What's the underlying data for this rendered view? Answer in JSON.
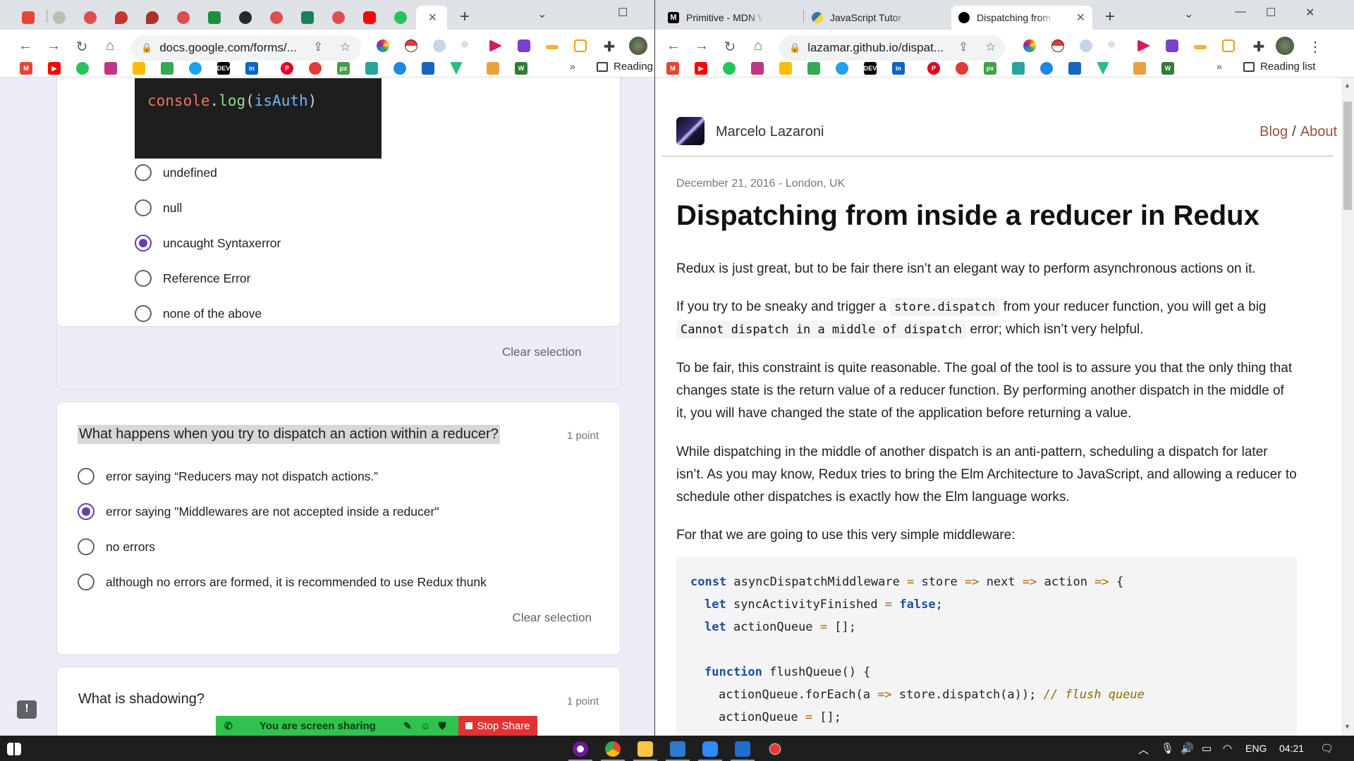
{
  "left_window": {
    "tabs": {
      "active_close": "✕",
      "new_tab": "+"
    },
    "omnibox": {
      "url": "docs.google.com/forms/..."
    },
    "bookmarks": {
      "reading_list": "Reading",
      "more": "»"
    },
    "form": {
      "code_snippet": {
        "prefix": "console",
        "dot": ".",
        "fn": "log",
        "paren_open": "(",
        "arg": "isAuth",
        "paren_close": ")"
      },
      "q1": {
        "options": [
          "undefined",
          "null",
          "uncaught Syntaxerror",
          "Reference Error",
          "none of the above"
        ],
        "selected_index": 2,
        "clear": "Clear selection"
      },
      "q2": {
        "title": "What happens when you try to dispatch an action within a reducer?",
        "points": "1 point",
        "options": [
          "error saying “Reducers may not dispatch actions.”",
          "error saying \"Middlewares are not accepted inside a reducer\"",
          "no errors",
          "although no errors are formed, it is recommended to use Redux thunk"
        ],
        "selected_index": 1,
        "clear": "Clear selection"
      },
      "q3": {
        "title": "What is shadowing?",
        "points": "1 point"
      }
    },
    "share_bar": {
      "status": "You are screen sharing",
      "stop": "Stop Share"
    }
  },
  "right_window": {
    "tabs": [
      {
        "title": "Primitive - MDN W",
        "active": false
      },
      {
        "title": "JavaScript Tutor - V",
        "active": false
      },
      {
        "title": "Dispatching from i",
        "active": true
      }
    ],
    "new_tab": "+",
    "omnibox": {
      "url": "lazamar.github.io/dispat..."
    },
    "bookmarks": {
      "reading_list": "Reading list",
      "more": "»"
    },
    "blog": {
      "author": "Marcelo Lazaroni",
      "nav": {
        "blog": "Blog",
        "sep": "/",
        "about": "About"
      },
      "meta": "December 21, 2016 - London, UK",
      "title": "Dispatching from inside a reducer in Redux",
      "p1": "Redux is just great, but to be fair there isn’t an elegant way to perform asynchronous actions on it.",
      "p2": {
        "a": "If you try to be sneaky and trigger a",
        "code1": "store.dispatch",
        "b": "from your reducer function, you will get a big",
        "code2": "Cannot dispatch in a middle of dispatch",
        "c": "error; which isn’t very helpful."
      },
      "p3": "To be fair, this constraint is quite reasonable. The goal of the tool is to assure you that the only thing that changes state is the return value of a reducer function. By performing another dispatch in the middle of it, you will have changed the state of the application before returning a value.",
      "p4": "While dispatching in the middle of another dispatch is an anti-pattern, scheduling a dispatch for later isn’t. As you may know, Redux tries to bring the Elm Architecture to JavaScript, and allowing a reducer to schedule other dispatches is exactly how the Elm language works.",
      "p5": "For that we are going to use this very simple middleware:",
      "code": {
        "l1": {
          "kw": "const",
          "name": " asyncDispatchMiddleware ",
          "eq": "=",
          "a": " store ",
          "ar1": "=>",
          "b": " next ",
          "ar2": "=>",
          "c": " action ",
          "ar3": "=>",
          "d": " {"
        },
        "l2": {
          "kw": "let",
          "rest": " syncActivityFinished ",
          "eq": "=",
          "val": " false",
          "end": ";"
        },
        "l3": {
          "kw": "let",
          "rest": " actionQueue ",
          "eq": "=",
          "end": " [];"
        },
        "l5": {
          "kw": "function",
          "rest": " flushQueue() {"
        },
        "l6": {
          "a": "actionQueue.forEach(a ",
          "ar": "=>",
          "b": " store.dispatch(a)); ",
          "cm": "// flush queue"
        },
        "l7": {
          "a": "actionQueue ",
          "eq": "=",
          "b": " [];"
        }
      }
    }
  },
  "taskbar": {
    "lang": "ENG",
    "time": "04:21"
  },
  "colors": {
    "accent": "#673ab7",
    "link": "#9c4e3a",
    "share_green": "#31c14f",
    "share_red": "#e23232"
  }
}
